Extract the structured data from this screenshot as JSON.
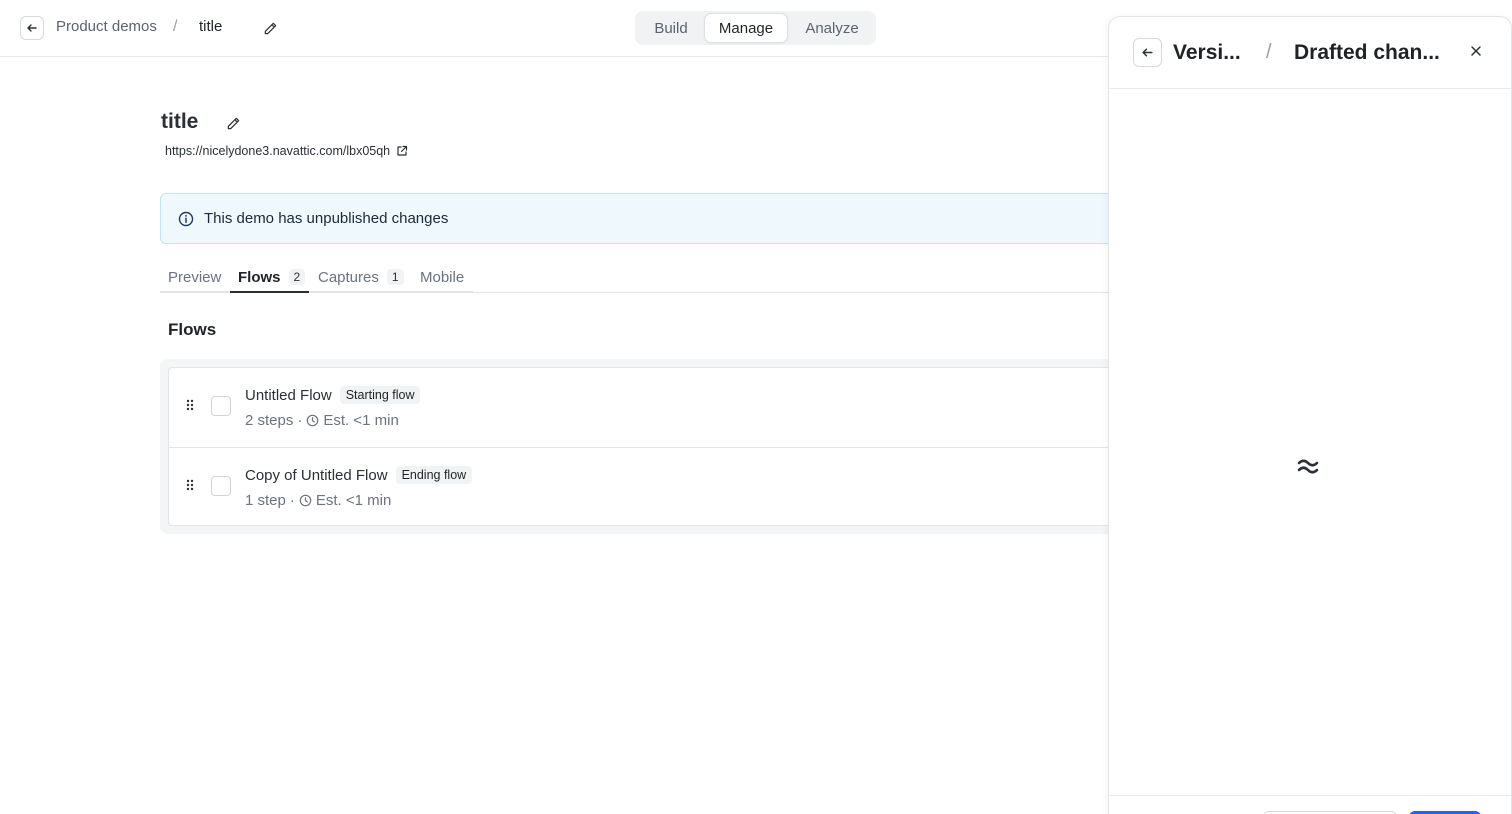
{
  "header": {
    "breadcrumb_parent": "Product demos",
    "breadcrumb_separator": "/",
    "breadcrumb_current": "title",
    "modes": [
      "Build",
      "Manage",
      "Analyze"
    ],
    "active_mode": "Manage"
  },
  "demo": {
    "title": "title",
    "url": "https://nicelydone3.navattic.com/lbx05qh"
  },
  "banner": {
    "text": "This demo has unpublished changes"
  },
  "tabs": [
    {
      "label": "Preview",
      "count": ""
    },
    {
      "label": "Flows",
      "count": "2"
    },
    {
      "label": "Captures",
      "count": "1"
    },
    {
      "label": "Mobile",
      "count": ""
    }
  ],
  "active_tab": "Flows",
  "flows_section": {
    "title": "Flows",
    "flows": [
      {
        "name": "Untitled Flow",
        "tag": "Starting flow",
        "steps": "2 steps",
        "estimate": "Est. <1 min"
      },
      {
        "name": "Copy of Untitled Flow",
        "tag": "Ending flow",
        "steps": "1 step",
        "estimate": "Est. <1 min"
      }
    ]
  },
  "panel": {
    "crumb_parent": "Versi...",
    "separator": "/",
    "crumb_current": "Drafted chan..."
  },
  "colors": {
    "banner_bg": "#eef8fd",
    "banner_border": "#c3e4f3",
    "primary": "#2563eb"
  }
}
